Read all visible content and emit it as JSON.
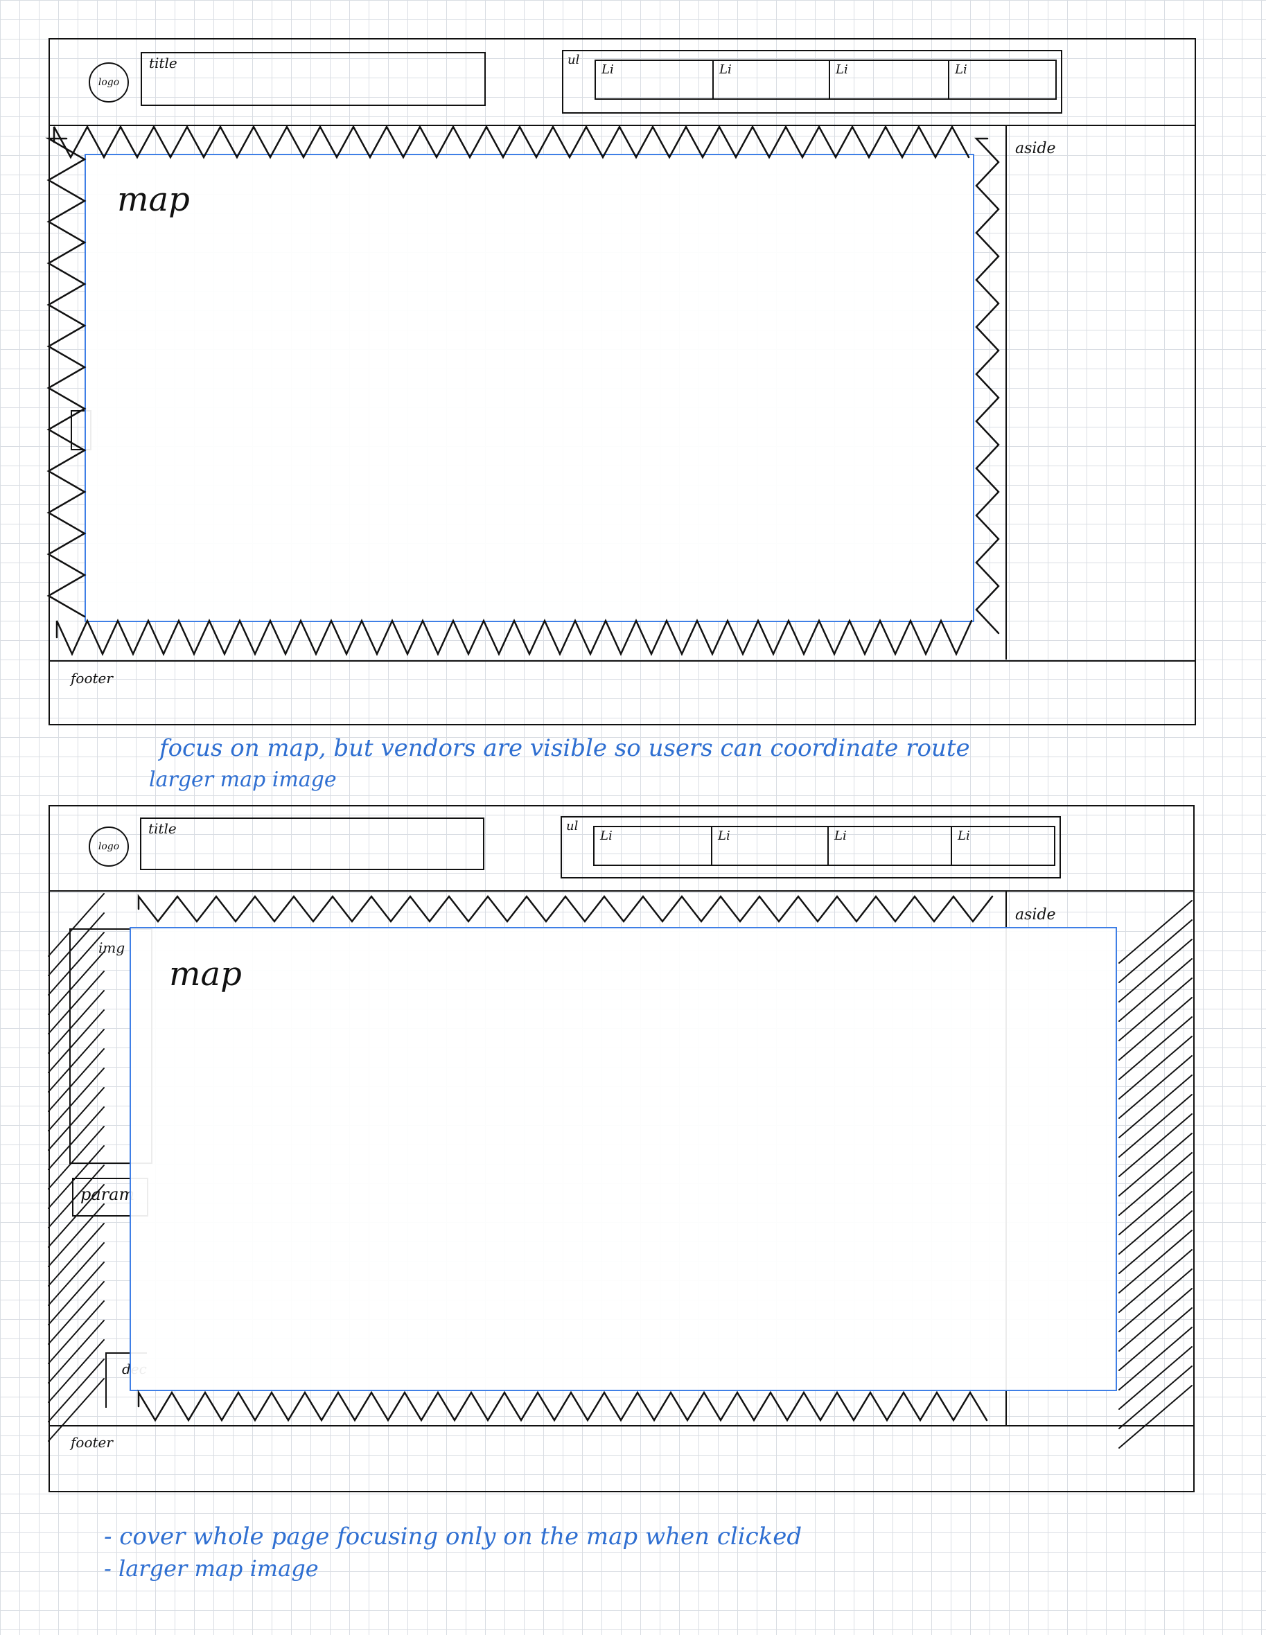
{
  "sketch1": {
    "logo": "logo",
    "title": "title",
    "ul": "ul",
    "nav_items": [
      "Li",
      "Li",
      "Li",
      "Li"
    ],
    "map": "map",
    "aside": "aside",
    "footer": "footer",
    "annotation": [
      "focus on map, but vendors are visible so users can coordinate route",
      "larger map image"
    ]
  },
  "sketch2": {
    "logo": "logo",
    "title": "title",
    "ul": "ul",
    "nav_items": [
      "Li",
      "Li",
      "Li",
      "Li"
    ],
    "img_label": "img",
    "map": "map",
    "param": "param",
    "dec": "dec",
    "aside": "aside",
    "footer": "footer",
    "annotation": [
      "- cover whole page focusing only on the map when clicked",
      "- larger map image"
    ]
  },
  "colors": {
    "ink": "#111111",
    "note_blue": "#2f6fd1",
    "map_outline": "#3f7fe6",
    "grid": "#d9dde3"
  }
}
